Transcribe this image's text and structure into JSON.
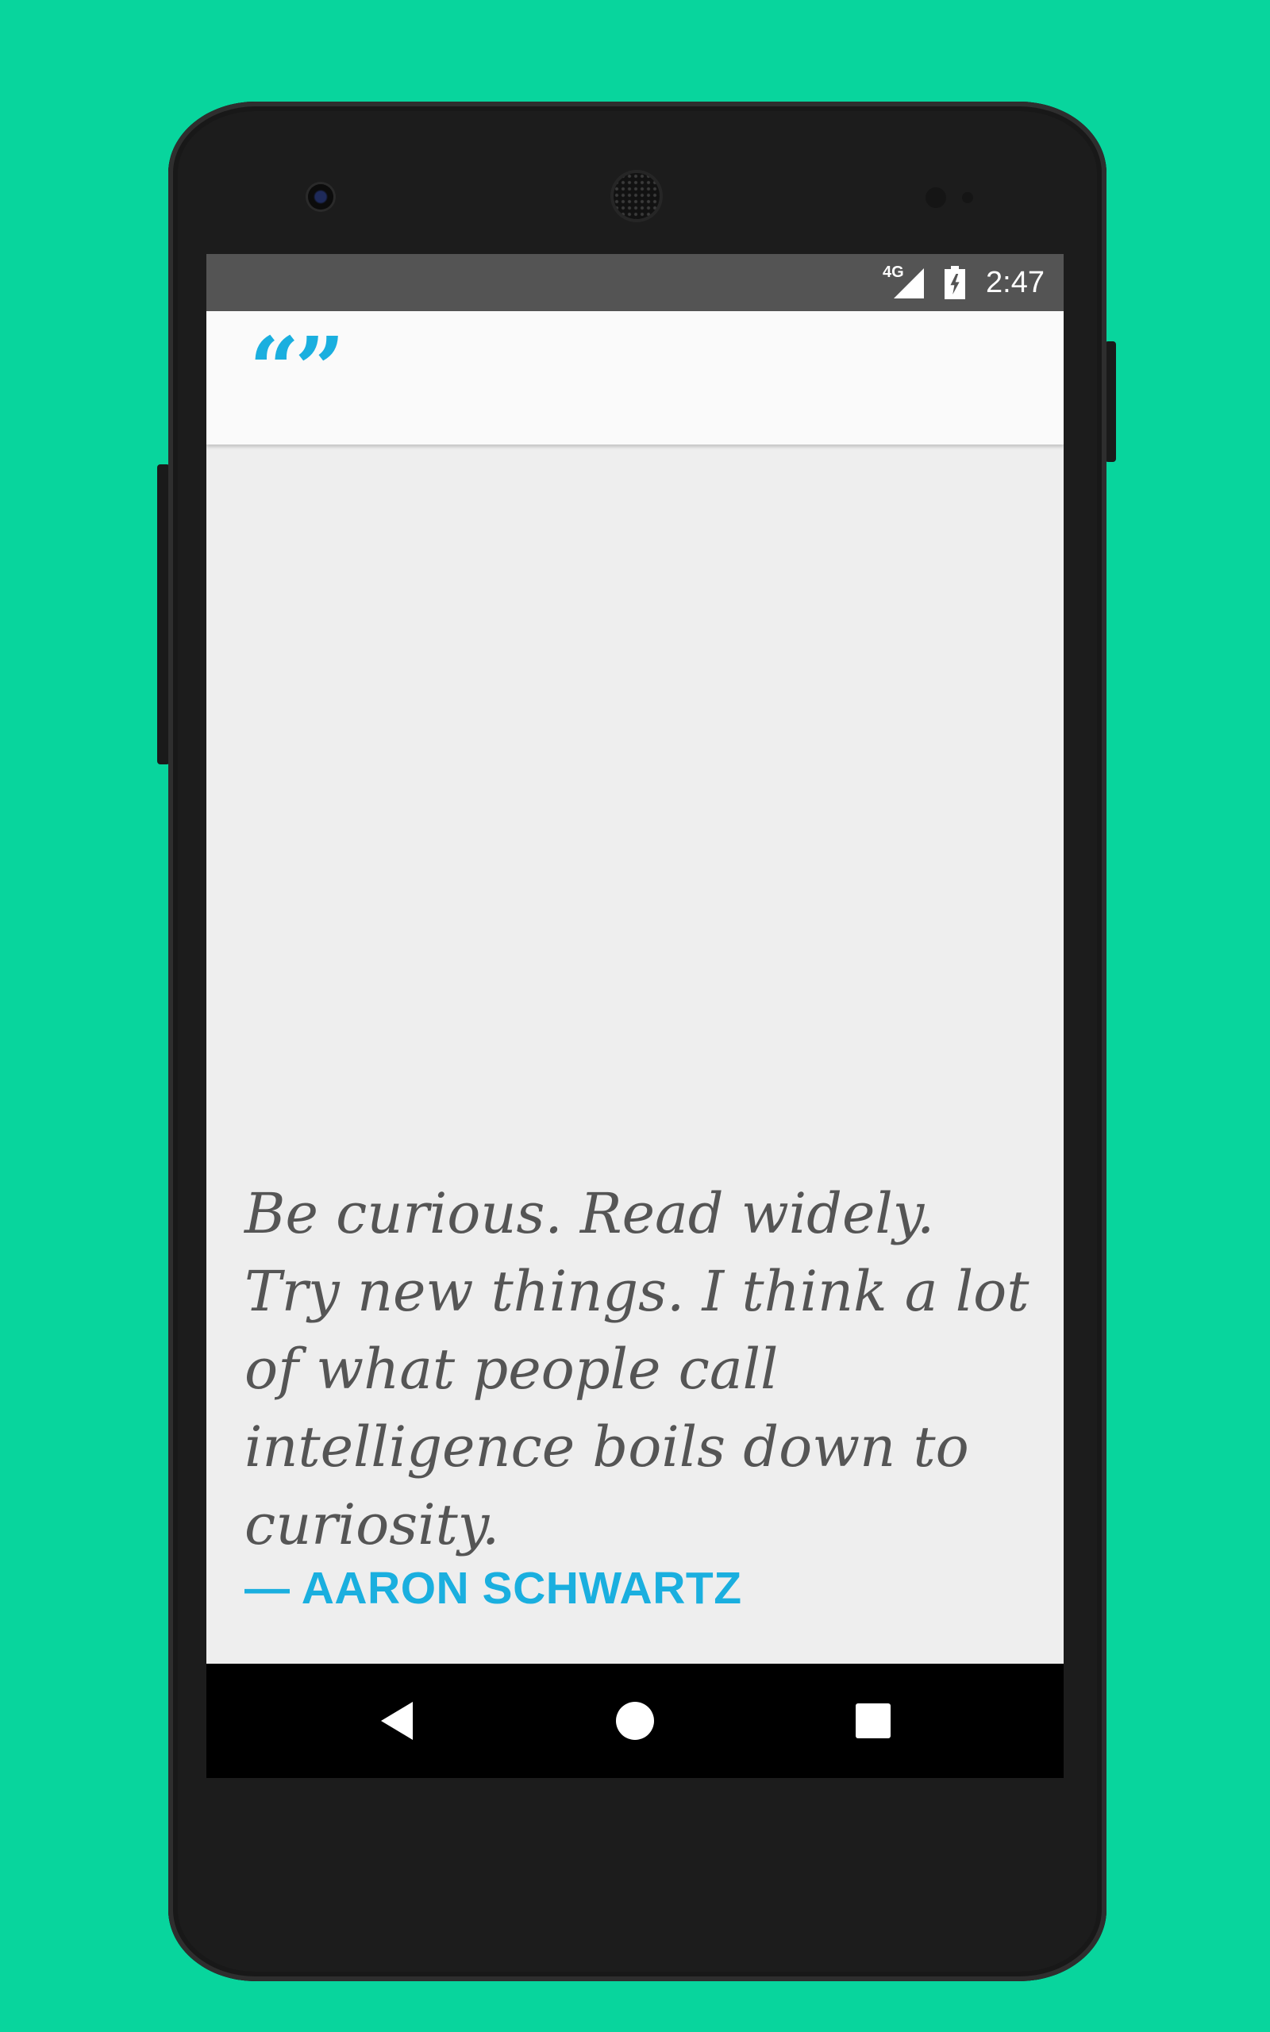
{
  "status_bar": {
    "network": "4G",
    "time": "2:47"
  },
  "app_bar": {
    "logo": "“”"
  },
  "quote": {
    "text": "Be curious. Read widely. Try new things. I think a lot of what people call intelligence boils down to curiosity.",
    "author": "— AARON SCHWARTZ"
  },
  "colors": {
    "background": "#08d59d",
    "accent": "#1aafdf",
    "quote_text": "#555555",
    "screen_bg": "#eeeeee"
  },
  "icons": {
    "signal": "signal-icon",
    "battery": "battery-charging-icon",
    "back": "back-icon",
    "home": "home-icon",
    "recents": "recents-icon"
  }
}
